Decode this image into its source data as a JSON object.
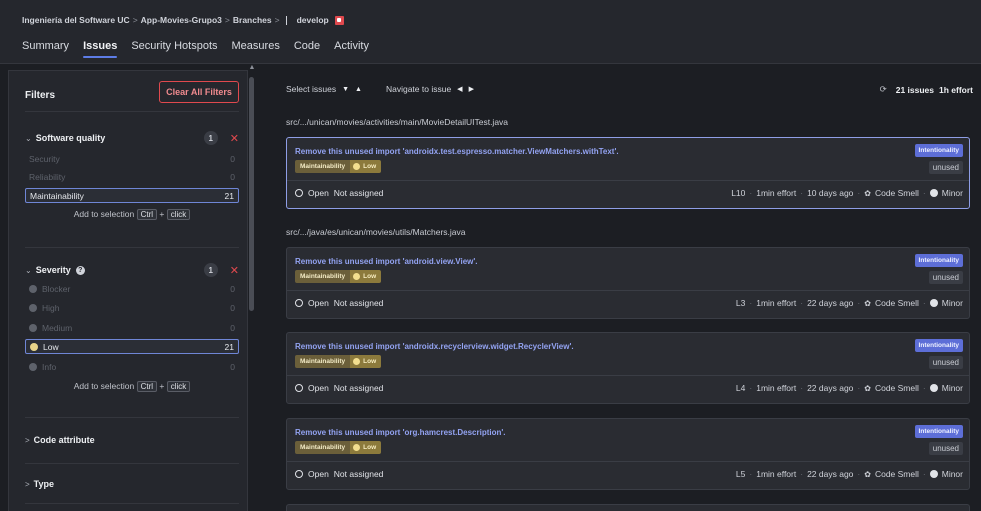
{
  "breadcrumb": {
    "org": "Ingeniería del Software UC",
    "project": "App-Movies-Grupo3",
    "branches": "Branches",
    "branch": "develop",
    "separator": ">"
  },
  "tabs": [
    {
      "label": "Summary",
      "active": false
    },
    {
      "label": "Issues",
      "active": true
    },
    {
      "label": "Security Hotspots",
      "active": false
    },
    {
      "label": "Measures",
      "active": false
    },
    {
      "label": "Code",
      "active": false
    },
    {
      "label": "Activity",
      "active": false
    }
  ],
  "filters": {
    "title": "Filters",
    "clear_all": "Clear All Filters",
    "software_quality": {
      "title": "Software quality",
      "count": "1",
      "items": [
        {
          "label": "Security",
          "count": "0"
        },
        {
          "label": "Reliability",
          "count": "0"
        },
        {
          "label": "Maintainability",
          "count": "21"
        }
      ]
    },
    "severity": {
      "title": "Severity",
      "count": "1",
      "items": [
        {
          "label": "Blocker",
          "count": "0"
        },
        {
          "label": "High",
          "count": "0"
        },
        {
          "label": "Medium",
          "count": "0"
        },
        {
          "label": "Low",
          "count": "21"
        },
        {
          "label": "Info",
          "count": "0"
        }
      ]
    },
    "add_selection": {
      "text": "Add to selection",
      "key1": "Ctrl",
      "plus": "+",
      "key2": "click"
    },
    "code_attribute": "Code attribute",
    "type": "Type"
  },
  "toolbar": {
    "select_issues": "Select issues",
    "navigate": "Navigate to issue",
    "issues_count": "21 issues",
    "effort": "1h effort"
  },
  "issues": [
    {
      "path": "src/.../unican/movies/activities/main/MovieDetailUITest.java",
      "message": "Remove this unused import 'androidx.test.espresso.matcher.ViewMatchers.withText'.",
      "quality": "Maintainability",
      "severity": "Low",
      "attribute": "Intentionality",
      "tag": "unused",
      "status": "Open",
      "assignee": "Not assigned",
      "line": "L10",
      "effort": "1min effort",
      "age": "10 days ago",
      "type": "Code Smell",
      "impact": "Minor"
    },
    {
      "path": "src/.../java/es/unican/movies/utils/Matchers.java",
      "message": "Remove this unused import 'android.view.View'.",
      "quality": "Maintainability",
      "severity": "Low",
      "attribute": "Intentionality",
      "tag": "unused",
      "status": "Open",
      "assignee": "Not assigned",
      "line": "L3",
      "effort": "1min effort",
      "age": "22 days ago",
      "type": "Code Smell",
      "impact": "Minor"
    },
    {
      "message": "Remove this unused import 'androidx.recyclerview.widget.RecyclerView'.",
      "quality": "Maintainability",
      "severity": "Low",
      "attribute": "Intentionality",
      "tag": "unused",
      "status": "Open",
      "assignee": "Not assigned",
      "line": "L4",
      "effort": "1min effort",
      "age": "22 days ago",
      "type": "Code Smell",
      "impact": "Minor"
    },
    {
      "message": "Remove this unused import 'org.hamcrest.Description'.",
      "quality": "Maintainability",
      "severity": "Low",
      "attribute": "Intentionality",
      "tag": "unused",
      "status": "Open",
      "assignee": "Not assigned",
      "line": "L5",
      "effort": "1min effort",
      "age": "22 days ago",
      "type": "Code Smell",
      "impact": "Minor"
    }
  ],
  "colors": {
    "background": "#1c1e23",
    "panel": "#25272d",
    "accent": "#5d7ce6",
    "issue_link": "#93a3f2",
    "danger": "#e0494e",
    "low_badge": "#8c7a3c"
  }
}
